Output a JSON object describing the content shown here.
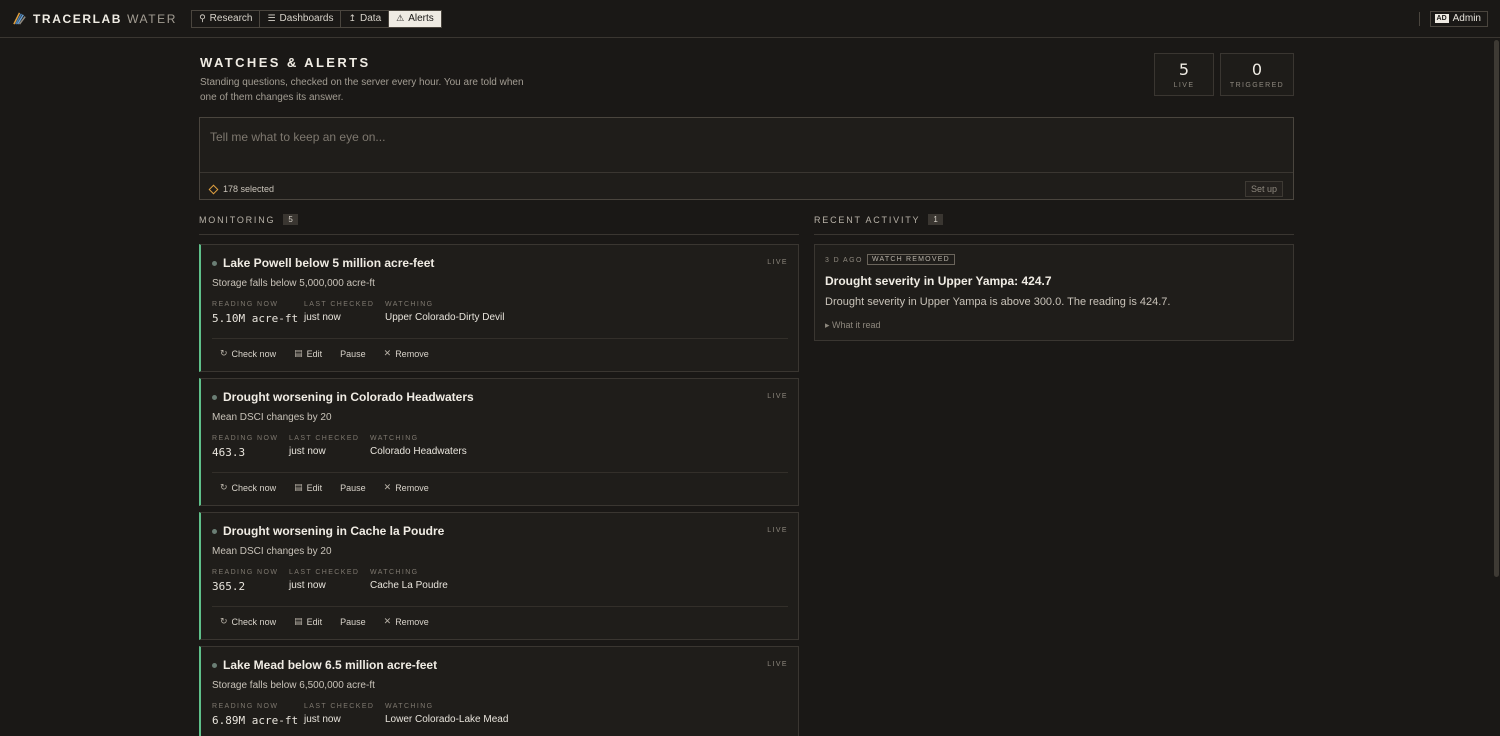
{
  "app": {
    "brand": "TRACERLAB",
    "brand_sub": "WATER",
    "accent": "#5fc08a",
    "warning": "#e0a040"
  },
  "nav": [
    {
      "label": "Research",
      "icon": "search-icon",
      "active": false
    },
    {
      "label": "Dashboards",
      "icon": "layers-icon",
      "active": false
    },
    {
      "label": "Data",
      "icon": "upload-icon",
      "active": false
    },
    {
      "label": "Alerts",
      "icon": "alert-triangle-icon",
      "active": true
    }
  ],
  "user": {
    "badge": "AD",
    "label": "Admin"
  },
  "header": {
    "title": "WATCHES & ALERTS",
    "subtitle": "Standing questions, checked on the server every hour. You are told when one of them changes its answer."
  },
  "stats": [
    {
      "value": "5",
      "label": "LIVE"
    },
    {
      "value": "0",
      "label": "TRIGGERED"
    }
  ],
  "prompt": {
    "placeholder": "Tell me what to keep an eye on...",
    "selected": "178 selected",
    "setup_label": "Set up"
  },
  "monitoring": {
    "label": "MONITORING",
    "count": "5",
    "meta_labels": {
      "reading": "READING NOW",
      "checked": "LAST CHECKED",
      "watching": "WATCHING"
    },
    "status_label": "LIVE",
    "actions": {
      "check": "Check now",
      "edit": "Edit",
      "pause": "Pause",
      "remove": "Remove"
    },
    "watches": [
      {
        "title": "Lake Powell below 5 million acre-feet",
        "desc": "Storage falls below 5,000,000 acre-ft",
        "reading": "5.10M acre-ft",
        "checked": "just now",
        "watching": "Upper Colorado-Dirty Devil"
      },
      {
        "title": "Drought worsening in Colorado Headwaters",
        "desc": "Mean DSCI changes by 20",
        "reading": "463.3",
        "checked": "just now",
        "watching": "Colorado Headwaters"
      },
      {
        "title": "Drought worsening in Cache la Poudre",
        "desc": "Mean DSCI changes by 20",
        "reading": "365.2",
        "checked": "just now",
        "watching": "Cache La Poudre"
      },
      {
        "title": "Lake Mead below 6.5 million acre-feet",
        "desc": "Storage falls below 6,500,000 acre-ft",
        "reading": "6.89M acre-ft",
        "checked": "just now",
        "watching": "Lower Colorado-Lake Mead"
      }
    ]
  },
  "activity": {
    "label": "RECENT ACTIVITY",
    "count": "1",
    "items": [
      {
        "when": "3 D AGO",
        "badge": "WATCH REMOVED",
        "title": "Drought severity in Upper Yampa: 424.7",
        "body": "Drought severity in Upper Yampa is above 300.0. The reading is 424.7.",
        "more": "What it read"
      }
    ]
  }
}
